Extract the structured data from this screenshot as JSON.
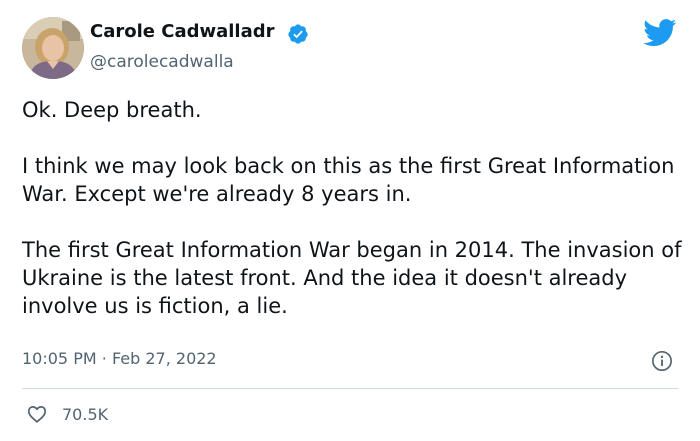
{
  "author": {
    "name": "Carole Cadwalladr",
    "handle": "@carolecadwalla",
    "verified": true
  },
  "tweet": {
    "paragraphs": [
      "Ok. Deep breath.",
      "I think we may look back on this as the first Great Information War. Except we're already 8 years in.",
      "The first Great Information War began in 2014. The invasion of Ukraine is the latest front. And the idea it doesn't already involve us is fiction, a lie."
    ],
    "time": "10:05 PM",
    "separator": "·",
    "date": "Feb 27, 2022"
  },
  "engagement": {
    "likes": "70.5K"
  },
  "icons": {
    "brand": "twitter-bird-icon",
    "verified": "verified-badge-icon",
    "info": "info-icon",
    "like": "heart-icon"
  },
  "colors": {
    "twitter_blue": "#1d9bf0",
    "text_primary": "#0f1419",
    "text_secondary": "#536471",
    "divider": "#cfd9de"
  }
}
